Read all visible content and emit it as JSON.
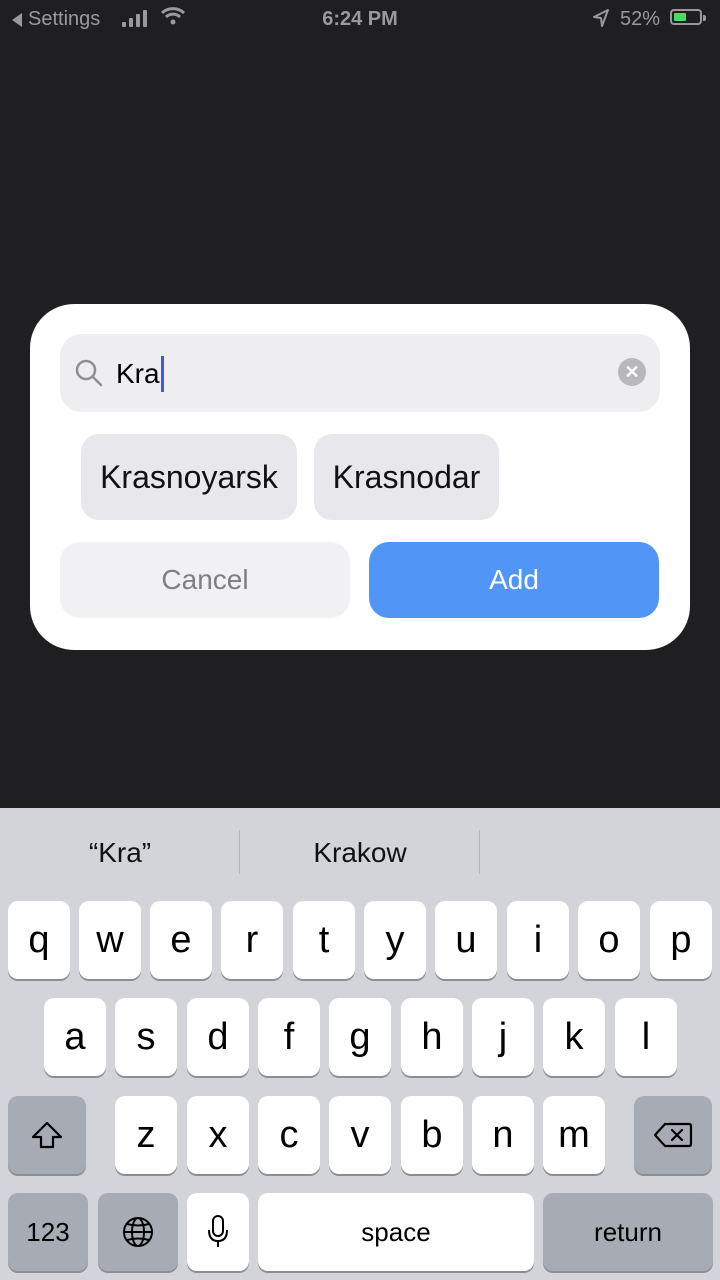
{
  "status_bar": {
    "back_label": "Settings",
    "time": "6:24 PM",
    "battery": "52%",
    "battery_level": 0.52
  },
  "dialog": {
    "search": {
      "value": "Kra"
    },
    "suggestions": [
      "Krasnoyarsk",
      "Krasnodar"
    ],
    "cancel_label": "Cancel",
    "add_label": "Add"
  },
  "keyboard": {
    "predictions": [
      "“Kra”",
      "Krakow",
      ""
    ],
    "row1": [
      "q",
      "w",
      "e",
      "r",
      "t",
      "y",
      "u",
      "i",
      "o",
      "p"
    ],
    "row2": [
      "a",
      "s",
      "d",
      "f",
      "g",
      "h",
      "j",
      "k",
      "l"
    ],
    "row3": [
      "z",
      "x",
      "c",
      "v",
      "b",
      "n",
      "m"
    ],
    "numbers_label": "123",
    "space_label": "space",
    "return_label": "return"
  },
  "colors": {
    "accent": "#5196f7",
    "background": "#1f1f21",
    "keyboard_bg": "#d2d4da"
  }
}
